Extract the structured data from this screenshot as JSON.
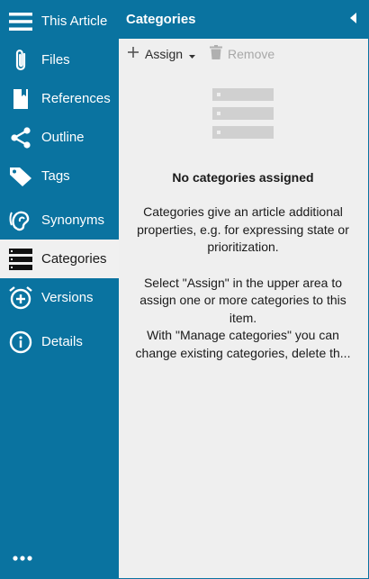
{
  "sidebar": {
    "items": [
      {
        "label": "This Article",
        "icon": "hamburger-menu-icon"
      },
      {
        "label": "Files",
        "icon": "paperclip-icon"
      },
      {
        "label": "References",
        "icon": "bookmark-book-icon"
      },
      {
        "label": "Outline",
        "icon": "share-nodes-icon"
      },
      {
        "label": "Tags",
        "icon": "tag-icon"
      },
      {
        "label": "Synonyms",
        "icon": "ear-icon"
      },
      {
        "label": "Categories",
        "icon": "categories-list-icon",
        "active": true
      },
      {
        "label": "Versions",
        "icon": "alarm-clock-plus-icon"
      },
      {
        "label": "Details",
        "icon": "info-circle-icon"
      }
    ],
    "more_icon": "more-dots-icon"
  },
  "panel": {
    "title": "Categories",
    "collapse_icon": "triangle-left-icon",
    "toolbar": {
      "assign_label": "Assign",
      "remove_label": "Remove"
    },
    "empty": {
      "title": "No categories assigned",
      "line1": "Categories give an article additional properties, e.g. for expressing state or prioritization.",
      "line2": "Select \"Assign\" in the upper area to assign one or more categories to this item.",
      "line3a": "With \"Manage categories\" you can",
      "line3b": "change existing categories, delete th..."
    }
  },
  "colors": {
    "brand": "#0a73a0",
    "panel_bg": "#efefef",
    "active_bg": "#f0f0f0",
    "disabled_text": "#a8a8a8"
  }
}
